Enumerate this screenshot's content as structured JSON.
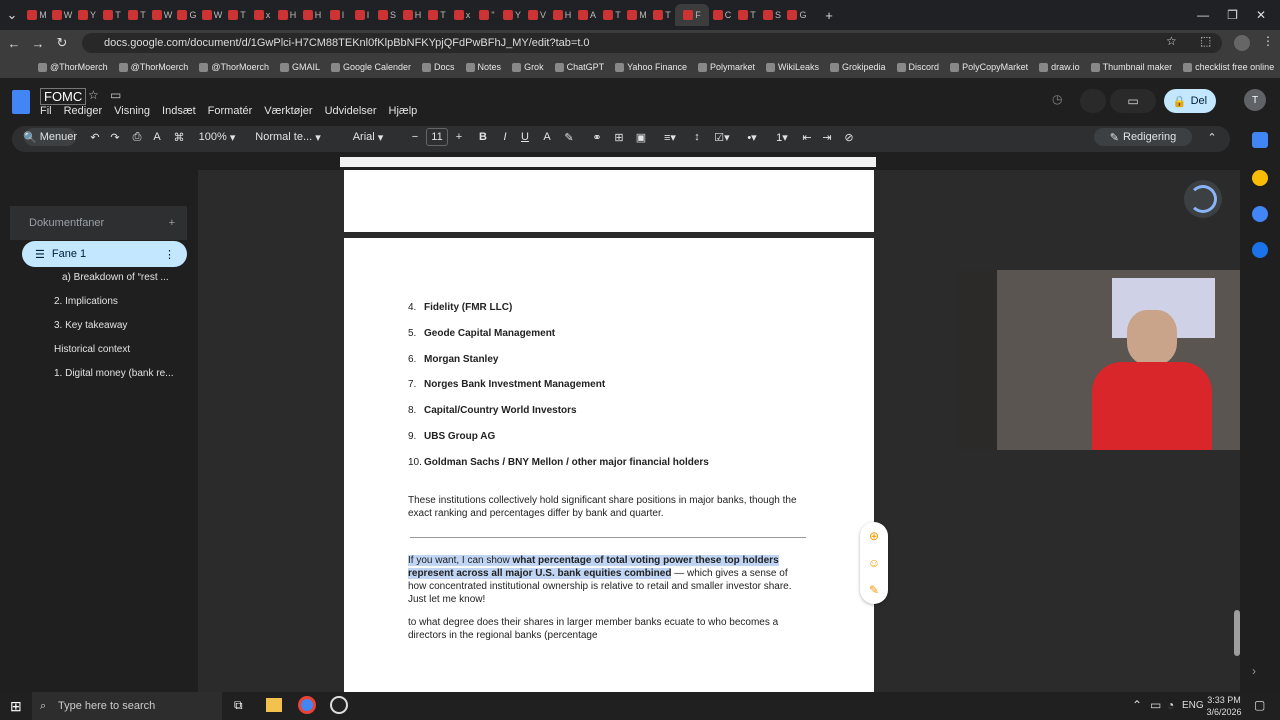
{
  "tabs": [
    {
      "t": "M"
    },
    {
      "t": "W"
    },
    {
      "t": "Y"
    },
    {
      "t": "T"
    },
    {
      "t": "T"
    },
    {
      "t": "W"
    },
    {
      "t": "G"
    },
    {
      "t": "W"
    },
    {
      "t": "T"
    },
    {
      "t": "x"
    },
    {
      "t": "H"
    },
    {
      "t": "H"
    },
    {
      "t": "I"
    },
    {
      "t": "I"
    },
    {
      "t": "S"
    },
    {
      "t": "H"
    },
    {
      "t": "T"
    },
    {
      "t": "x"
    },
    {
      "t": "\""
    },
    {
      "t": "Y"
    },
    {
      "t": "V"
    },
    {
      "t": "H"
    },
    {
      "t": "A"
    },
    {
      "t": "T"
    },
    {
      "t": "M"
    },
    {
      "t": "T"
    },
    {
      "t": "F"
    },
    {
      "t": "C"
    },
    {
      "t": "T"
    },
    {
      "t": "S"
    },
    {
      "t": "G"
    }
  ],
  "address": {
    "url": "docs.google.com/document/d/1GwPlci-H7CM88TEKnl0fKlpBbNFKYpjQFdPwBFhJ_MY/edit?tab=t.0"
  },
  "bookmarks": [
    "@ThorMoerch",
    "@ThorMoerch",
    "@ThorMoerch",
    "GMAIL",
    "Google Calender",
    "Docs",
    "Notes",
    "Grok",
    "ChatGPT",
    "Yahoo Finance",
    "Polymarket",
    "WikiLeaks",
    "Grokipedia",
    "Discord",
    "PolyCopyMarket",
    "draw.io",
    "Thumbnail maker",
    "checklist free online"
  ],
  "doc": {
    "title": "FOMC",
    "menus": [
      "Fil",
      "Rediger",
      "Visning",
      "Indsæt",
      "Formatér",
      "Værktøjer",
      "Udvidelser",
      "Hjælp"
    ],
    "share": "Del",
    "avatar": "T"
  },
  "toolbar": {
    "menus": "Menuer",
    "zoom": "100%",
    "style": "Normal te...",
    "font": "Arial",
    "size": "11",
    "mode": "Redigering"
  },
  "sidebar": {
    "header": "Dokumentfaner",
    "tab": "Fane 1",
    "items": [
      "a) Breakdown of “rest ...",
      "2. Implications",
      "3. Key takeaway",
      "Historical context",
      "1. Digital money (bank re..."
    ]
  },
  "list": [
    {
      "n": "4.",
      "t": "Fidelity (FMR LLC)"
    },
    {
      "n": "5.",
      "t": "Geode Capital Management"
    },
    {
      "n": "6.",
      "t": "Morgan Stanley"
    },
    {
      "n": "7.",
      "t": "Norges Bank Investment Management"
    },
    {
      "n": "8.",
      "t": "Capital/Country World Investors"
    },
    {
      "n": "9.",
      "t": "UBS Group AG"
    },
    {
      "n": "10.",
      "t": "Goldman Sachs / BNY Mellon / other major financial holders"
    }
  ],
  "p1": "These institutions collectively hold significant share positions in major banks, though the exact ranking and percentages differ by bank and quarter.",
  "p2a": "If you want, I can show ",
  "p2b": "what percentage of total voting power these top holders represent across all major U.S. bank equities combined",
  "p2c": " — which gives a sense of how concentrated institutional ownership is relative to retail and smaller investor share. Just let me know!",
  "p3": "to what degree does their shares in larger member banks ecuate to who becomes a directors in the regional banks (percentage",
  "taskbar": {
    "search": "Type here to search",
    "lang": "ENG",
    "time": "3:33 PM",
    "date": "3/6/2026"
  }
}
